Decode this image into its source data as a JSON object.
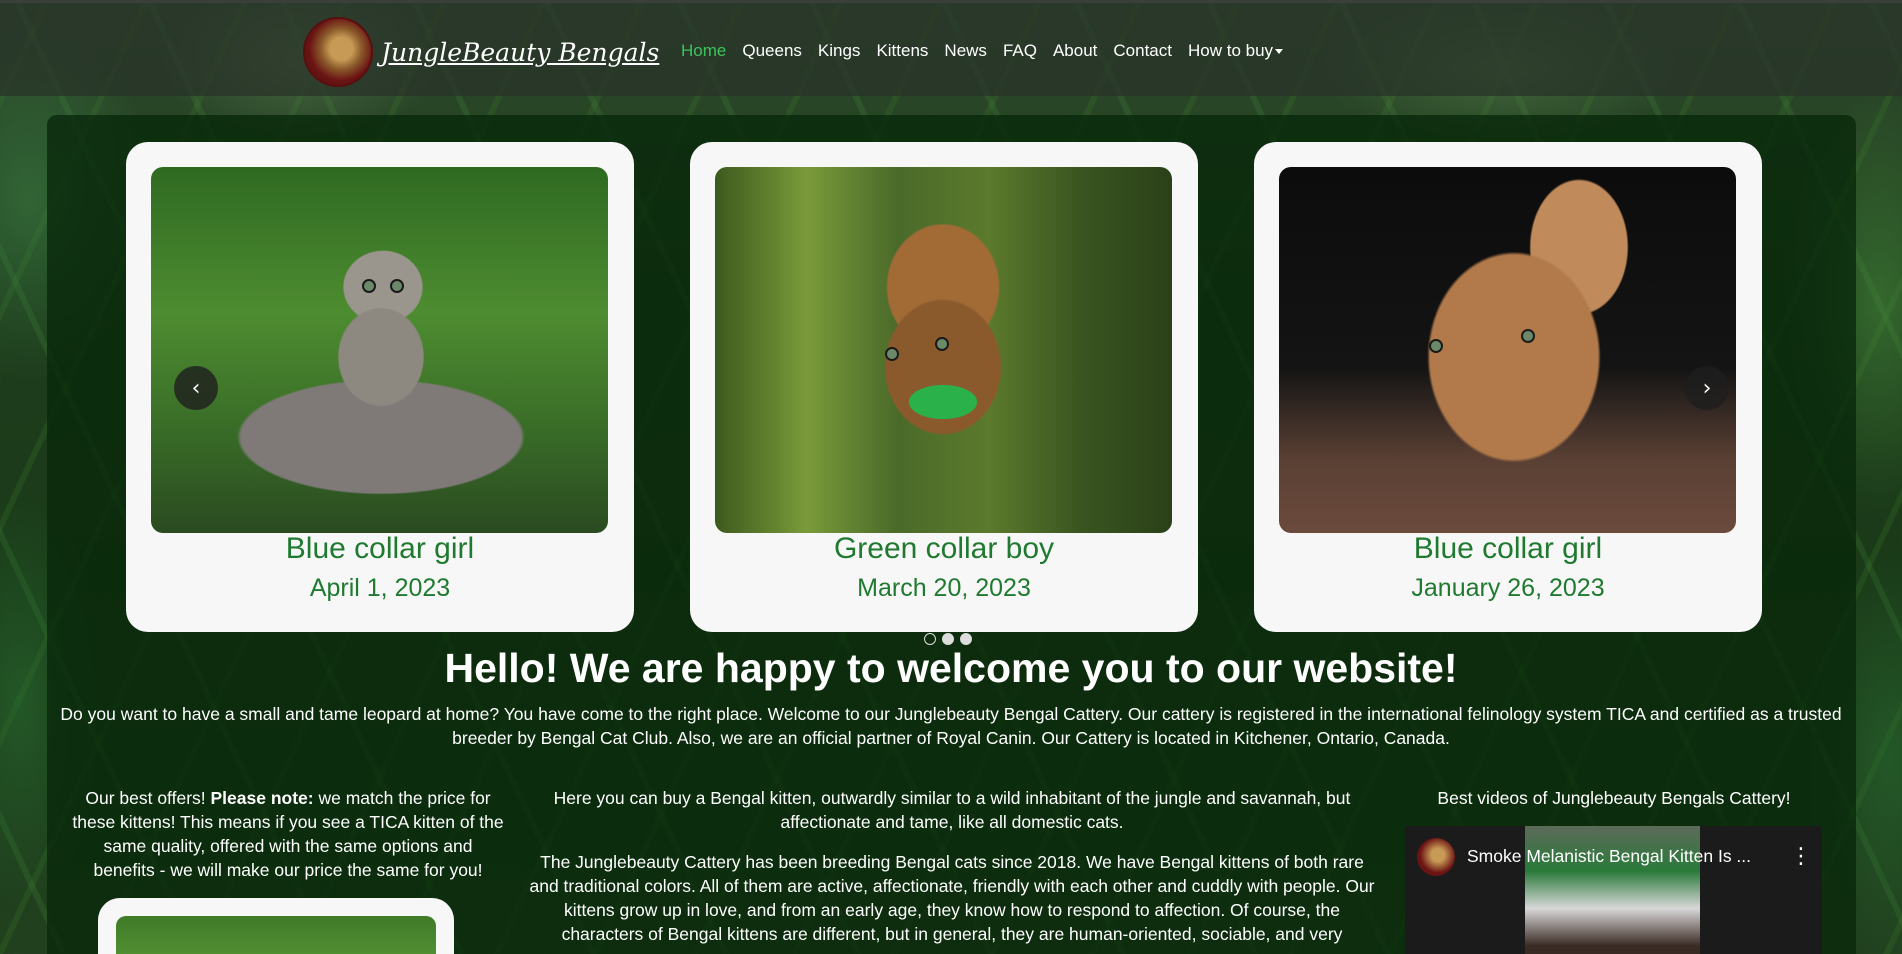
{
  "brand": {
    "name": "JungleBeauty Bengals"
  },
  "nav": {
    "home": "Home",
    "queens": "Queens",
    "kings": "Kings",
    "kittens": "Kittens",
    "news": "News",
    "faq": "FAQ",
    "about": "About",
    "contact": "Contact",
    "how_to_buy": "How to buy"
  },
  "carousel": {
    "slides": [
      {
        "title": "Blue collar girl",
        "date": "April 1, 2023"
      },
      {
        "title": "Green collar boy",
        "date": "March 20, 2023"
      },
      {
        "title": "Blue collar girl",
        "date": "January 26, 2023"
      }
    ],
    "prev_symbol": "‹",
    "next_symbol": "›",
    "indicator_count": 3,
    "active_indicator": 0
  },
  "welcome": {
    "headline": "Hello! We are happy to welcome you to our website!",
    "intro": "Do you want to have a small and tame leopard at home? You have come to the right place. Welcome to our Junglebeauty Bengal Cattery. Our cattery is registered in the international felinology system TICA and certified as a trusted breeder by Bengal Cat Club. Also, we are an official partner of Royal Canin. Our Cattery is located in Kitchener, Ontario, Canada."
  },
  "offers": {
    "lead": "Our best offers! ",
    "note_label": "Please note:",
    "text": " we match the price for these kittens! This means if you see a TICA kitten of the same quality, offered with the same options and benefits - we will make our price the same for you!"
  },
  "about_col": {
    "p1": "Here you can buy a Bengal kitten, outwardly similar to a wild inhabitant of the jungle and savannah, but affectionate and tame, like all domestic cats.",
    "p2": "The Junglebeauty Cattery has been breeding Bengal cats since 2018. We have Bengal kittens of both rare and traditional colors. All of them are active, affectionate, friendly with each other and cuddly with people. Our kittens grow up in love, and from an early age, they know how to respond to affection. Of course, the characters of Bengal kittens are different, but in general, they are human-oriented, sociable, and very"
  },
  "videos": {
    "heading": "Best videos of Junglebeauty Bengals Cattery!",
    "video_title": "Smoke Melanistic Bengal Kitten Is ...",
    "menu_symbol": "⋮"
  }
}
